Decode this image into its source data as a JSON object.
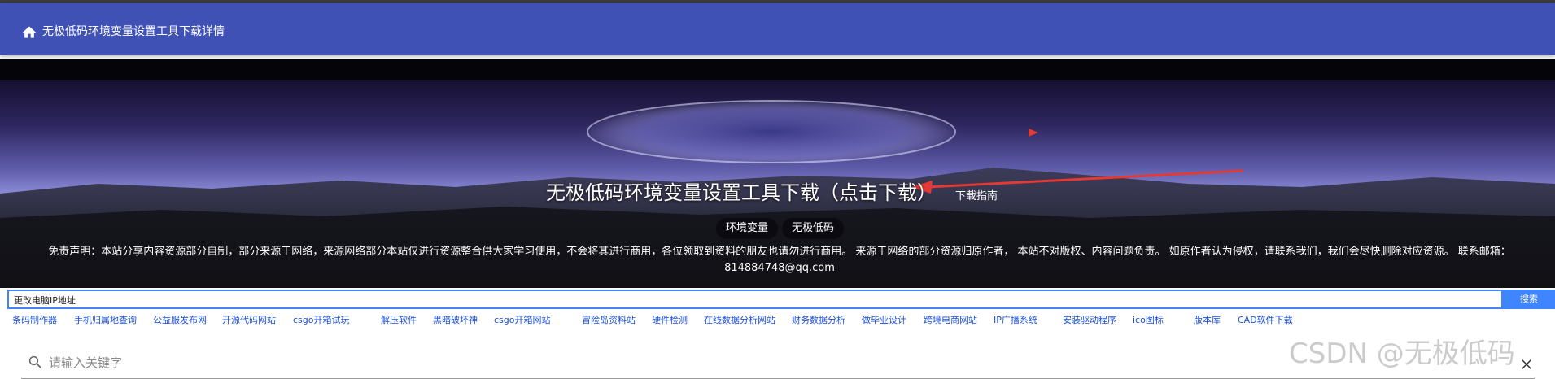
{
  "app_bar": {
    "title": "无极低码环境变量设置工具下载详情"
  },
  "banner": {
    "title": "无极低码环境变量设置工具下载（点击下载）",
    "guide": "下载指南",
    "tags": [
      "环境变量",
      "无极低码"
    ],
    "disclaimer": "免责声明：本站分享内容资源部分自制，部分来源于网络，来源网络部分本站仅进行资源整合供大家学习使用，不会将其进行商用，各位领取到资料的朋友也请勿进行商用。 来源于网络的部分资源归原作者， 本站不对版权、内容问题负责。 如原作者认为侵权，请联系我们，我们会尽快删除对应资源。 联系邮箱：814884748@qq.com"
  },
  "search": {
    "value": "更改电脑IP地址",
    "button": "搜索"
  },
  "quick_links": [
    "条码制作器",
    "手机归属地查询",
    "公益服发布网",
    "开源代码网站",
    "csgo开箱试玩",
    "解压软件",
    "黑暗破坏神",
    "csgo开箱网站",
    "冒险岛资料站",
    "硬件检测",
    "在线数据分析网站",
    "财务数据分析",
    "做毕业设计",
    "跨境电商网站",
    "IP广播系统",
    "安装驱动程序",
    "ico图标",
    "版本库",
    "CAD软件下载"
  ],
  "keyword_search": {
    "placeholder": "请输入关键字"
  },
  "watermark": "CSDN @无极低码",
  "colors": {
    "app_bar": "#3f51b5",
    "search_accent": "#3f85ff",
    "link": "#1a4fd6",
    "arrow": "#e53935"
  }
}
